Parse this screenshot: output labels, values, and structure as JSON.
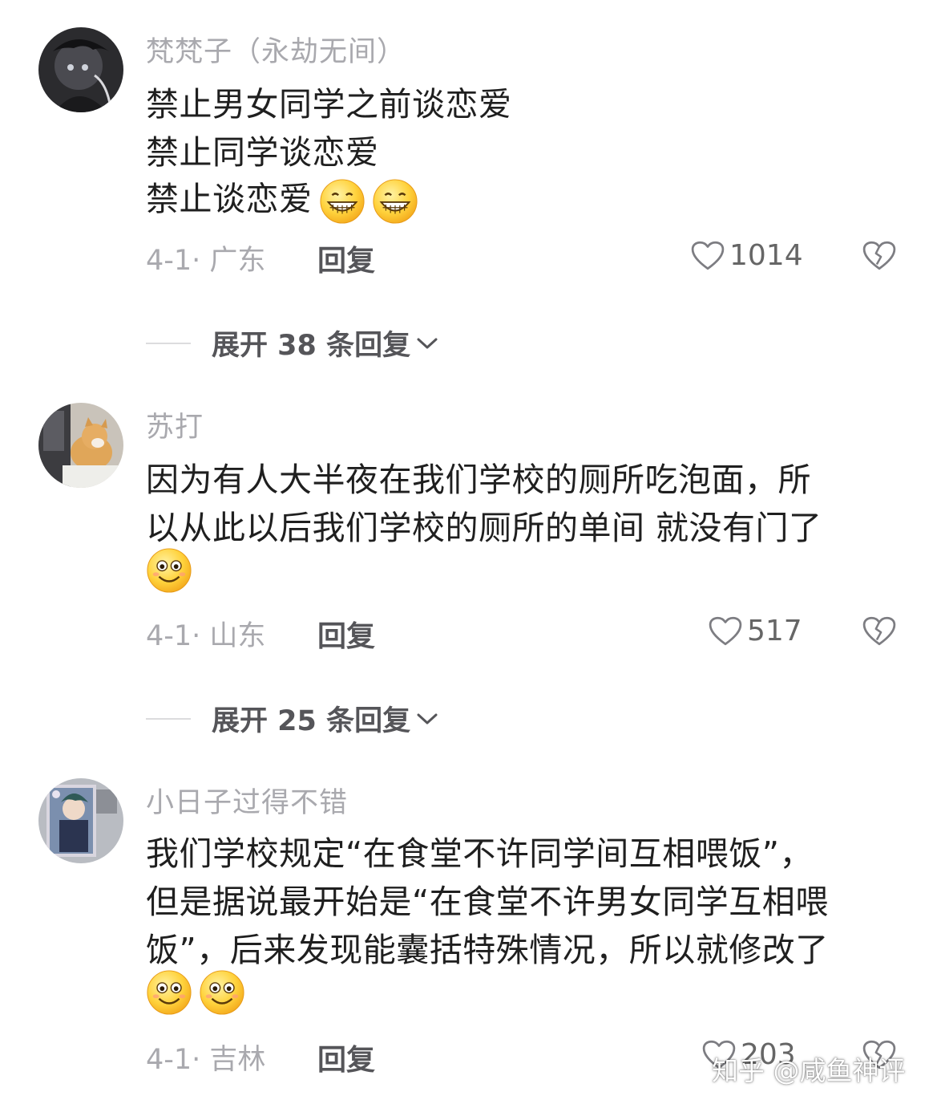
{
  "comments": [
    {
      "username": "梵梵子（永劫无间）",
      "lines": [
        "禁止男女同学之前谈恋爱",
        "禁止同学谈恋爱",
        "禁止谈恋爱"
      ],
      "emojis": [
        "grin-emoji",
        "grin-emoji"
      ],
      "meta": "4-1· 广东",
      "reply_label": "回复",
      "likes": "1014",
      "expand_label": "展开 38 条回复"
    },
    {
      "username": "苏打",
      "lines": [
        "因为有人大半夜在我们学校的厕所吃泡面，所",
        "以从此以后我们学校的厕所的单间 就没有门了"
      ],
      "emojis": [
        "smile-emoji"
      ],
      "meta": "4-1· 山东",
      "reply_label": "回复",
      "likes": "517",
      "expand_label": "展开 25 条回复"
    },
    {
      "username": "小日子过得不错",
      "lines": [
        "我们学校规定“在食堂不许同学间互相喂饭”，",
        "但是据说最开始是“在食堂不许男女同学互相喂",
        "饭”，后来发现能囊括特殊情况，所以就修改了"
      ],
      "emojis": [
        "smile-emoji",
        "smile-emoji"
      ],
      "meta": "4-1· 吉林",
      "reply_label": "回复",
      "likes": "203"
    }
  ],
  "watermark": "知乎 @咸鱼神评",
  "colors": {
    "text": "#1f1f1f",
    "meta": "#a9a9ae",
    "emoji_yellow": "#ffd23c"
  }
}
